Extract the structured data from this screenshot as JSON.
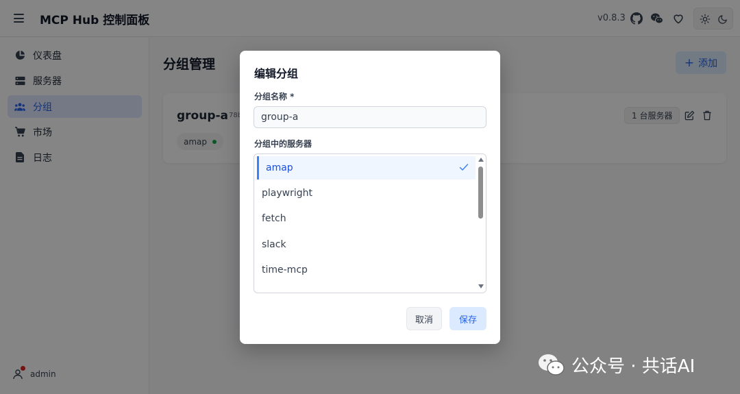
{
  "header": {
    "title": "MCP Hub 控制面板",
    "version": "v0.8.3",
    "icons": [
      "github-icon",
      "wechat-icon",
      "heart-icon",
      "sun-icon",
      "moon-icon"
    ]
  },
  "sidebar": {
    "items": [
      {
        "label": "仪表盘",
        "icon": "dashboard-icon",
        "active": false
      },
      {
        "label": "服务器",
        "icon": "server-icon",
        "active": false
      },
      {
        "label": "分组",
        "icon": "users-icon",
        "active": true
      },
      {
        "label": "市场",
        "icon": "cart-icon",
        "active": false
      },
      {
        "label": "日志",
        "icon": "file-icon",
        "active": false
      }
    ],
    "user": {
      "name": "admin"
    }
  },
  "main": {
    "page_title": "分组管理",
    "add_label": "添加",
    "group_card": {
      "name": "group-a",
      "id_fragment": "78b",
      "server_chip": "amap",
      "count_label": "1 台服务器"
    }
  },
  "modal": {
    "title": "编辑分组",
    "name_label": "分组名称 *",
    "name_value": "group-a",
    "servers_label": "分组中的服务器",
    "servers": [
      {
        "label": "amap",
        "selected": true
      },
      {
        "label": "playwright",
        "selected": false
      },
      {
        "label": "fetch",
        "selected": false
      },
      {
        "label": "slack",
        "selected": false
      },
      {
        "label": "time-mcp",
        "selected": false
      }
    ],
    "cancel_label": "取消",
    "save_label": "保存"
  },
  "watermark": {
    "text": "公众号 · 共话AI"
  },
  "colors": {
    "accent": "#2563eb",
    "accent_bg": "#dbeafe",
    "status_green": "#16a34a",
    "notification_red": "#dc2626"
  }
}
